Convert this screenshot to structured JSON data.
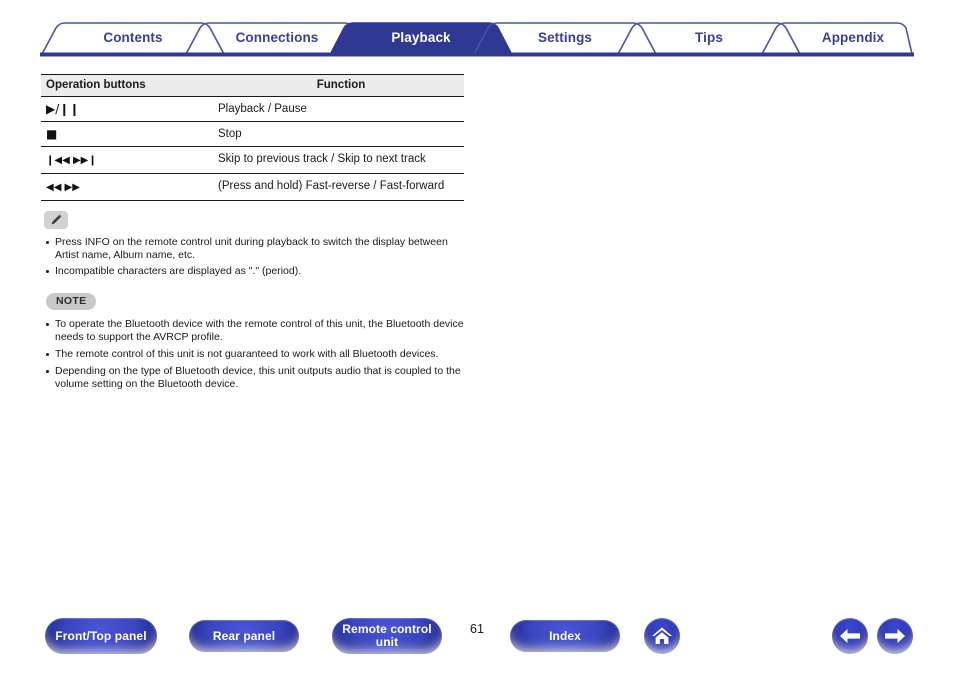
{
  "tabs": [
    {
      "label": "Contents",
      "active": false
    },
    {
      "label": "Connections",
      "active": false
    },
    {
      "label": "Playback",
      "active": true
    },
    {
      "label": "Settings",
      "active": false
    },
    {
      "label": "Tips",
      "active": false
    },
    {
      "label": "Appendix",
      "active": false
    }
  ],
  "table": {
    "headers": [
      "Operation buttons",
      "Function"
    ],
    "rows": [
      {
        "buttons": "▶/❙❙",
        "function": "Playback / Pause"
      },
      {
        "buttons": "■",
        "function": "Stop"
      },
      {
        "buttons": "❙◀◀ ▶▶❙",
        "function": "Skip to previous track / Skip to next track"
      },
      {
        "buttons": "◀◀ ▶▶",
        "function": "(Press and hold) Fast-reverse / Fast-forward"
      }
    ]
  },
  "info": {
    "icon": "pencil-icon",
    "bullets": [
      "Press INFO on the remote control unit during playback to switch the display between Artist name, Album name, etc.",
      "Incompatible characters are displayed as \".\" (period)."
    ]
  },
  "note": {
    "badge": "NOTE",
    "bullets": [
      "To operate the Bluetooth device with the remote control of this unit, the Bluetooth device needs to support the AVRCP profile.",
      "The remote control of this unit is not guaranteed to work with all Bluetooth devices.",
      "Depending on the type of Bluetooth device, this unit outputs audio that is coupled to the volume setting on the Bluetooth device."
    ]
  },
  "footer": {
    "buttons": [
      {
        "label": "Front/Top panel",
        "name": "front-top-panel-button"
      },
      {
        "label": "Rear panel",
        "name": "rear-panel-button"
      },
      {
        "label": "Remote control unit",
        "name": "remote-control-unit-button"
      },
      {
        "label": "Index",
        "name": "index-button"
      }
    ],
    "page_number": "61",
    "home_icon": "home-icon",
    "prev_icon": "arrow-left-icon",
    "next_icon": "arrow-right-icon"
  },
  "colors": {
    "tab_border": "#4a52a8",
    "tab_text": "#3b3f96",
    "tab_active_bg": "#2f3893",
    "rule": "#1c2270",
    "table_header_bg": "#ececec",
    "badge_gray": "#c9c9c9",
    "button_blue": "#3a45c0"
  }
}
